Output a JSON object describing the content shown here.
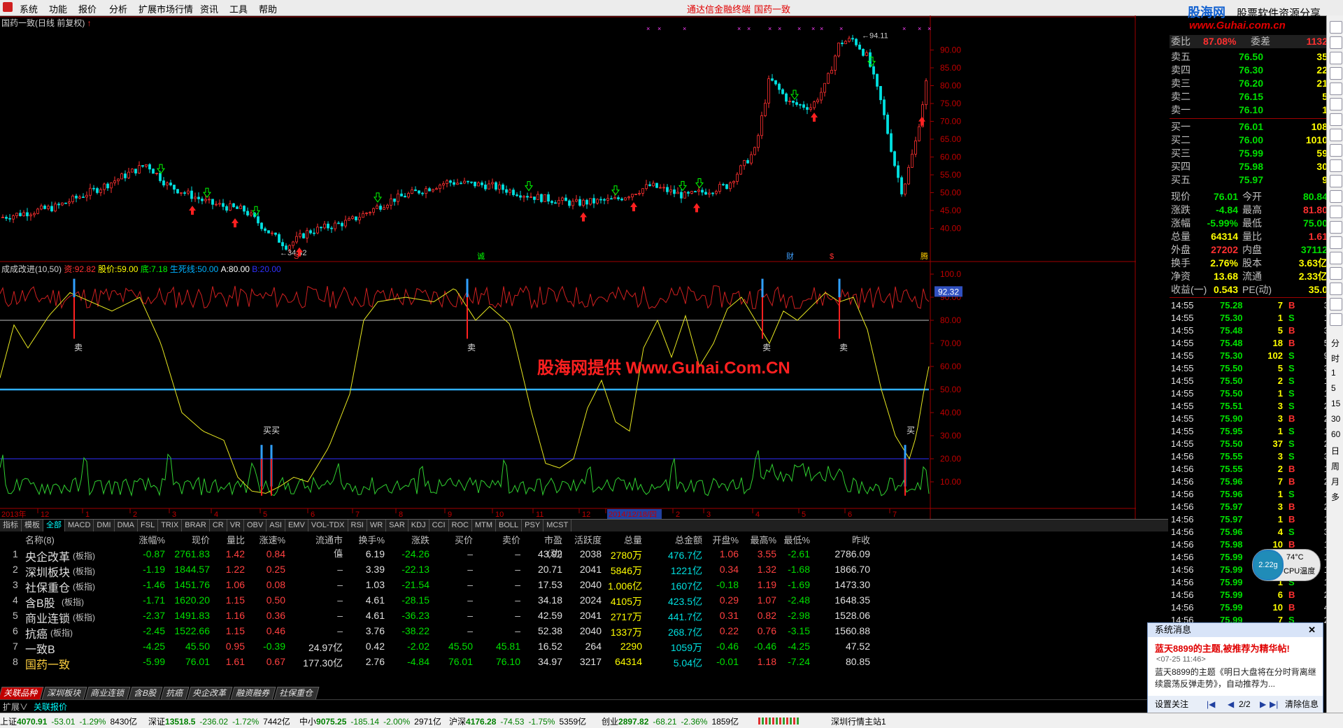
{
  "menu": {
    "items": [
      "系统",
      "功能",
      "报价",
      "分析",
      "扩展市场行情",
      "资讯",
      "工具",
      "帮助"
    ],
    "center_items": [
      "通达信金融终端",
      "国药一致"
    ]
  },
  "brand": {
    "name": "股海网",
    "slogan": "股票软件资源分享",
    "url": "www.Guhai.com.cn"
  },
  "chart": {
    "title": "国药一致(日线 前复权)",
    "price_labels": [
      "90.00",
      "85.00",
      "80.00",
      "75.00",
      "70.00",
      "65.00",
      "60.00",
      "55.00",
      "50.00",
      "45.00",
      "40.00"
    ],
    "high_label": "94.11",
    "low_label": "34.42",
    "event_markers": [
      "S",
      "诚",
      "财",
      "$",
      "腾"
    ],
    "indicator": {
      "name": "成成改进(10,50)",
      "lines": [
        {
          "label": "资:",
          "value": "92.82",
          "color": "#ff3030"
        },
        {
          "label": "股价:",
          "value": "59.00",
          "color": "#ffff00"
        },
        {
          "label": "底:",
          "value": "7.18",
          "color": "#00ff00"
        },
        {
          "label": "生死线:",
          "value": "50.00",
          "color": "#00b0ff"
        },
        {
          "label": "A:",
          "value": "80.00",
          "color": "#ffffff"
        },
        {
          "label": "B:",
          "value": "20.00",
          "color": "#2020ff"
        }
      ]
    },
    "indicator_ticks": [
      "100.0",
      "90.00",
      "80.00",
      "70.00",
      "60.00",
      "50.00",
      "40.00",
      "30.00",
      "20.00",
      "10.00"
    ],
    "current_value_tag": "92.32",
    "signals": {
      "sell": "卖",
      "buy": "买"
    },
    "buy_double": "买买",
    "x_labels": [
      "2013年",
      "12",
      "1",
      "2",
      "3",
      "4",
      "5",
      "6",
      "7",
      "8",
      "9",
      "10",
      "11",
      "12",
      "2014/12/18/四",
      "2",
      "3",
      "4",
      "5",
      "6",
      "7"
    ],
    "period": "日线",
    "watermark": "股海网提供 Www.Guhai.Com.CN"
  },
  "indicator_tabs": [
    "指标",
    "模板",
    "全部",
    "MACD",
    "DMI",
    "DMA",
    "FSL",
    "TRIX",
    "BRAR",
    "CR",
    "VR",
    "OBV",
    "ASI",
    "EMV",
    "VOL-TDX",
    "RSI",
    "WR",
    "SAR",
    "KDJ",
    "CCI",
    "ROC",
    "MTM",
    "BOLL",
    "PSY",
    "MCST"
  ],
  "table": {
    "headers": [
      "名称(8)",
      "涨幅%",
      "现价",
      "量比",
      "涨速%",
      "流通市值",
      "换手%",
      "涨跌",
      "买价",
      "卖价",
      "市盈(动)",
      "活跃度",
      "总量",
      "总金额",
      "开盘%",
      "最高%",
      "最低%",
      "昨收"
    ],
    "rows": [
      {
        "no": "1",
        "name": "央企改革",
        "tag": "(板指)",
        "chg": "-0.87",
        "price": "2761.83",
        "lb": "1.42",
        "spd": "0.84",
        "cap": "–",
        "turn": "6.19",
        "diff": "-24.26",
        "bid": "–",
        "ask": "–",
        "pe": "43.92",
        "act": "2038",
        "vol": "2780万",
        "amt": "476.7亿",
        "open": "1.06",
        "high": "3.55",
        "low": "-2.61",
        "prev": "2786.09"
      },
      {
        "no": "2",
        "name": "深圳板块",
        "tag": "(板指)",
        "chg": "-1.19",
        "price": "1844.57",
        "lb": "1.22",
        "spd": "0.25",
        "cap": "–",
        "turn": "3.39",
        "diff": "-22.13",
        "bid": "–",
        "ask": "–",
        "pe": "20.71",
        "act": "2041",
        "vol": "5846万",
        "amt": "1221亿",
        "open": "0.34",
        "high": "1.32",
        "low": "-1.68",
        "prev": "1866.70"
      },
      {
        "no": "3",
        "name": "社保重仓",
        "tag": "(板指)",
        "chg": "-1.46",
        "price": "1451.76",
        "lb": "1.06",
        "spd": "0.08",
        "cap": "–",
        "turn": "1.03",
        "diff": "-21.54",
        "bid": "–",
        "ask": "–",
        "pe": "17.53",
        "act": "2040",
        "vol": "1.006亿",
        "amt": "1607亿",
        "open": "-0.18",
        "high": "1.19",
        "low": "-1.69",
        "prev": "1473.30"
      },
      {
        "no": "4",
        "name": "含B股",
        "tag": "(板指)",
        "chg": "-1.71",
        "price": "1620.20",
        "lb": "1.15",
        "spd": "0.50",
        "cap": "–",
        "turn": "4.61",
        "diff": "-28.15",
        "bid": "–",
        "ask": "–",
        "pe": "34.18",
        "act": "2024",
        "vol": "4105万",
        "amt": "423.5亿",
        "open": "0.29",
        "high": "1.07",
        "low": "-2.48",
        "prev": "1648.35"
      },
      {
        "no": "5",
        "name": "商业连锁",
        "tag": "(板指)",
        "chg": "-2.37",
        "price": "1491.83",
        "lb": "1.16",
        "spd": "0.36",
        "cap": "–",
        "turn": "4.61",
        "diff": "-36.23",
        "bid": "–",
        "ask": "–",
        "pe": "42.59",
        "act": "2041",
        "vol": "2717万",
        "amt": "441.7亿",
        "open": "0.31",
        "high": "0.82",
        "low": "-2.98",
        "prev": "1528.06"
      },
      {
        "no": "6",
        "name": "抗癌",
        "tag": "(板指)",
        "chg": "-2.45",
        "price": "1522.66",
        "lb": "1.15",
        "spd": "0.46",
        "cap": "–",
        "turn": "3.76",
        "diff": "-38.22",
        "bid": "–",
        "ask": "–",
        "pe": "52.38",
        "act": "2040",
        "vol": "1337万",
        "amt": "268.7亿",
        "open": "0.22",
        "high": "0.76",
        "low": "-3.15",
        "prev": "1560.88"
      },
      {
        "no": "7",
        "name": "一致B",
        "tag": "",
        "chg": "-4.25",
        "price": "45.50",
        "lb": "0.95",
        "spd": "-0.39",
        "cap": "24.97亿",
        "turn": "0.42",
        "diff": "-2.02",
        "bid": "45.50",
        "ask": "45.81",
        "pe": "16.52",
        "act": "264",
        "vol": "2290",
        "amt": "1059万",
        "open": "-0.46",
        "high": "-0.46",
        "low": "-4.25",
        "prev": "47.52"
      },
      {
        "no": "8",
        "name": "国药一致",
        "tag": "",
        "chg": "-5.99",
        "price": "76.01",
        "lb": "1.61",
        "spd": "0.67",
        "cap": "177.30亿",
        "turn": "2.76",
        "diff": "-4.84",
        "bid": "76.01",
        "ask": "76.10",
        "pe": "34.97",
        "act": "3217",
        "vol": "64314",
        "amt": "5.04亿",
        "open": "-0.01",
        "high": "1.18",
        "low": "-7.24",
        "prev": "80.85"
      }
    ]
  },
  "bottom_tabs": [
    "关联品种",
    "深圳板块",
    "商业连锁",
    "含B股",
    "抗癌",
    "央企改革",
    "融资融券",
    "社保重仓"
  ],
  "ext_tabs": [
    "扩展∨",
    "关联报价"
  ],
  "orderbook": {
    "header": {
      "wb_label": "委比",
      "wb": "87.08%",
      "wc_label": "委差",
      "wc": "1132"
    },
    "sell": [
      {
        "label": "卖五",
        "price": "76.50",
        "qty": "35"
      },
      {
        "label": "卖四",
        "price": "76.30",
        "qty": "22"
      },
      {
        "label": "卖三",
        "price": "76.20",
        "qty": "21"
      },
      {
        "label": "卖二",
        "price": "76.15",
        "qty": "5"
      },
      {
        "label": "卖一",
        "price": "76.10",
        "qty": "1"
      }
    ],
    "buy": [
      {
        "label": "买一",
        "price": "76.01",
        "qty": "108"
      },
      {
        "label": "买二",
        "price": "76.00",
        "qty": "1010"
      },
      {
        "label": "买三",
        "price": "75.99",
        "qty": "59"
      },
      {
        "label": "买四",
        "price": "75.98",
        "qty": "30"
      },
      {
        "label": "买五",
        "price": "75.97",
        "qty": "9"
      }
    ],
    "stats": [
      {
        "l1": "现价",
        "v1": "76.01",
        "c1": "#00e000",
        "l2": "今开",
        "v2": "80.84",
        "c2": "#00e000"
      },
      {
        "l1": "涨跌",
        "v1": "-4.84",
        "c1": "#00e000",
        "l2": "最高",
        "v2": "81.80",
        "c2": "#ff3030"
      },
      {
        "l1": "涨幅",
        "v1": "-5.99%",
        "c1": "#00e000",
        "l2": "最低",
        "v2": "75.00",
        "c2": "#00e000"
      },
      {
        "l1": "总量",
        "v1": "64314",
        "c1": "#ffff00",
        "l2": "量比",
        "v2": "1.61",
        "c2": "#ff3030"
      },
      {
        "l1": "外盘",
        "v1": "27202",
        "c1": "#ff3030",
        "l2": "内盘",
        "v2": "37112",
        "c2": "#00e000"
      },
      {
        "l1": "换手",
        "v1": "2.76%",
        "c1": "#ffff00",
        "l2": "股本",
        "v2": "3.63亿",
        "c2": "#ffff00"
      },
      {
        "l1": "净资",
        "v1": "13.68",
        "c1": "#ffff00",
        "l2": "流通",
        "v2": "2.33亿",
        "c2": "#ffff00"
      },
      {
        "l1": "收益(一)",
        "v1": "0.543",
        "c1": "#ffff00",
        "l2": "PE(动)",
        "v2": "35.0",
        "c2": "#ffff00"
      }
    ],
    "ticks": [
      [
        "14:55",
        "75.28",
        "7",
        "B",
        "3"
      ],
      [
        "14:55",
        "75.30",
        "1",
        "S",
        "1"
      ],
      [
        "14:55",
        "75.48",
        "5",
        "B",
        "3"
      ],
      [
        "14:55",
        "75.48",
        "18",
        "B",
        "5"
      ],
      [
        "14:55",
        "75.30",
        "102",
        "S",
        "9"
      ],
      [
        "14:55",
        "75.50",
        "5",
        "S",
        "3"
      ],
      [
        "14:55",
        "75.50",
        "2",
        "S",
        "1"
      ],
      [
        "14:55",
        "75.50",
        "1",
        "S",
        "1"
      ],
      [
        "14:55",
        "75.51",
        "3",
        "S",
        "2"
      ],
      [
        "14:55",
        "75.90",
        "3",
        "B",
        "2"
      ],
      [
        "14:55",
        "75.95",
        "1",
        "S",
        "1"
      ],
      [
        "14:55",
        "75.50",
        "37",
        "S",
        "2"
      ],
      [
        "14:56",
        "75.55",
        "3",
        "S",
        "3"
      ],
      [
        "14:56",
        "75.55",
        "2",
        "B",
        "1"
      ],
      [
        "14:56",
        "75.96",
        "7",
        "B",
        "2"
      ],
      [
        "14:56",
        "75.96",
        "1",
        "S",
        "1"
      ],
      [
        "14:56",
        "75.97",
        "3",
        "B",
        "2"
      ],
      [
        "14:56",
        "75.97",
        "1",
        "B",
        "1"
      ],
      [
        "14:56",
        "75.96",
        "4",
        "S",
        "3"
      ],
      [
        "14:56",
        "75.98",
        "10",
        "B",
        "1"
      ],
      [
        "14:56",
        "75.99",
        "1",
        "S",
        "1"
      ],
      [
        "14:56",
        "75.99",
        "2",
        "S",
        "1"
      ],
      [
        "14:56",
        "75.99",
        "1",
        "S",
        "1"
      ],
      [
        "14:56",
        "75.99",
        "6",
        "B",
        "2"
      ],
      [
        "14:56",
        "75.99",
        "10",
        "B",
        "4"
      ],
      [
        "14:56",
        "75.99",
        "7",
        "S",
        "2"
      ]
    ]
  },
  "right_toolbar": {
    "labels": [
      "分",
      "时",
      "1",
      "5",
      "15",
      "30",
      "60",
      "日",
      "周",
      "月",
      "多"
    ]
  },
  "cpu": {
    "value": "2.22g",
    "temp": "74°C",
    "label": "CPU温度"
  },
  "popup": {
    "header": "系统消息",
    "title": "蓝天8899的主题,被推荐为精华帖!",
    "time": "07-25 11:46",
    "body": "蓝天8899的主题《明日大盘将在分时背离继续震荡反弹走势》，自动推荐为...",
    "set": "设置关注",
    "page": "2/2",
    "clear": "清除信息"
  },
  "status": {
    "sh": {
      "label": "上证",
      "val": "4070.91",
      "chg": "-53.01",
      "pct": "-1.29%",
      "amt": "8430亿"
    },
    "sz": {
      "label": "深证",
      "val": "13518.5",
      "chg": "-236.02",
      "pct": "-1.72%",
      "amt": "7442亿"
    },
    "zx": {
      "label": "中小",
      "val": "9075.25",
      "chg": "-185.14",
      "pct": "-2.00%",
      "amt": "2971亿"
    },
    "hs": {
      "label": "沪深",
      "val": "4176.28",
      "chg": "-74.53",
      "pct": "-1.75%",
      "amt": "5359亿"
    },
    "cy": {
      "label": "创业",
      "val": "2897.82",
      "chg": "-68.21",
      "pct": "-2.36%",
      "amt": "1859亿"
    },
    "site": "深圳行情主站1"
  }
}
